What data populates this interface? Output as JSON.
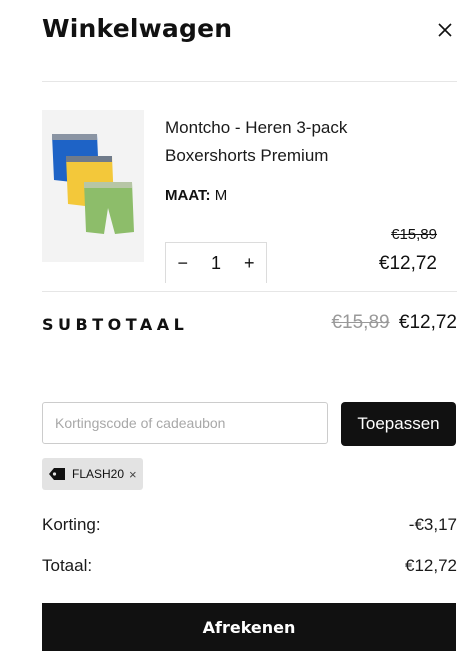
{
  "header": {
    "title": "Winkelwagen",
    "close_icon": "close-icon"
  },
  "item": {
    "name": "Montcho - Heren 3-pack Boxershorts Premium",
    "size_label": "MAAT:",
    "size_value": "M",
    "quantity": "1",
    "minus": "−",
    "plus": "+",
    "price_original": "€15,89",
    "price_current": "€12,72",
    "image_icon": "boxershorts-image",
    "brand_band": "MONTCHO"
  },
  "subtotal": {
    "label": "SUBTOTAAL",
    "original": "€15,89",
    "current": "€12,72"
  },
  "discount": {
    "placeholder": "Kortingscode of cadeaubon",
    "apply_label": "Toepassen",
    "applied_code": "FLASH20",
    "remove_glyph": "×"
  },
  "summary": {
    "korting_label": "Korting:",
    "korting_value": "-€3,17",
    "totaal_label": "Totaal:",
    "totaal_value": "€12,72"
  },
  "checkout": {
    "label": "Afrekenen"
  },
  "colors": {
    "primary": "#111111",
    "chip_bg": "#e3e3e3",
    "muted": "#999999"
  }
}
